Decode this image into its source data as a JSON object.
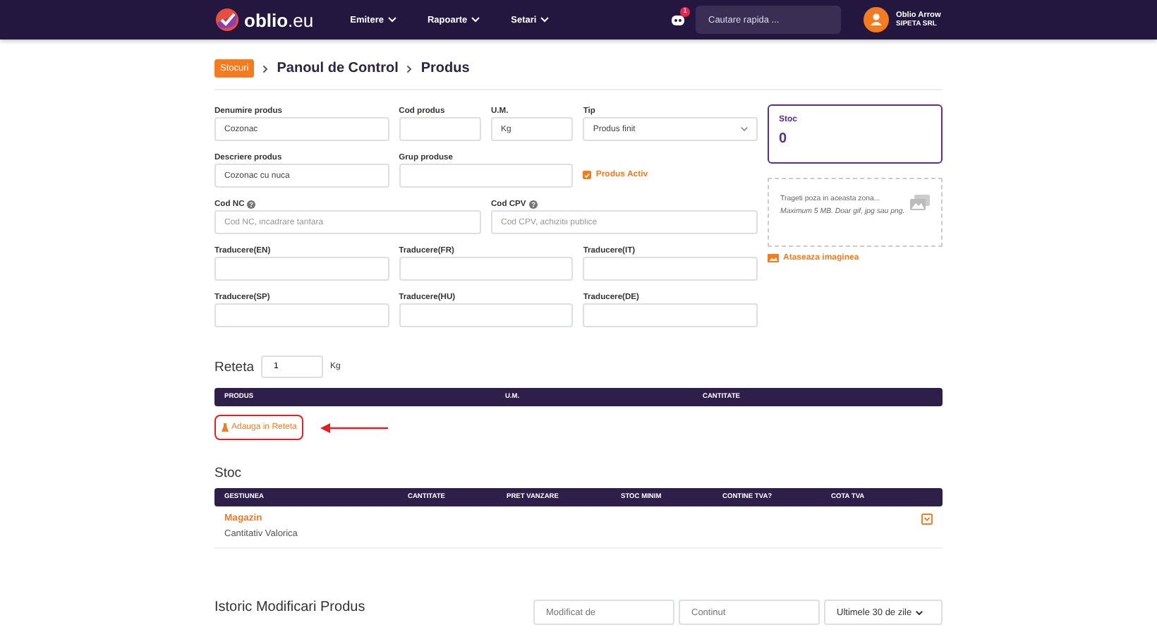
{
  "navbar": {
    "logo": "**oblio**.eu",
    "menu": [
      {
        "label": "Emitere"
      },
      {
        "label": "Rapoarte"
      },
      {
        "label": "Setari"
      }
    ],
    "notifications": "1",
    "search": {
      "placeholder": "Cautare rapida ..."
    },
    "user": {
      "name": "Oblio Arrow",
      "company": "SIPETA SRL"
    }
  },
  "breadcrumb": {
    "tag": "Stocuri",
    "items": [
      "Panoul de Control",
      "Produs"
    ]
  },
  "form_rows": [
    [
      {
        "kind": "text",
        "label": "Denumire produs",
        "value": "Cozonac"
      },
      {
        "kind": "short",
        "label": "Cod produs"
      },
      {
        "kind": "short",
        "label": "U.M.",
        "value": "Kg"
      },
      {
        "kind": "select",
        "label": "Tip",
        "value": "Produs finit"
      }
    ],
    [
      {
        "kind": "text",
        "label": "Descriere produs",
        "value": "Cozonac cu nuca"
      },
      {
        "kind": "text",
        "label": "Grup produse"
      },
      {
        "kind": "checkbox",
        "label": "Produs Activ",
        "checked": true
      }
    ],
    [
      {
        "kind": "text",
        "label": "Cod NC",
        "help_icon": true,
        "placeholder": "Cod NC, incadrare tarifara"
      },
      {
        "kind": "text",
        "label": "Cod CPV",
        "help_icon": true,
        "placeholder": "Cod CPV, achizitii publice"
      }
    ],
    [
      {
        "kind": "text",
        "label": "Traducere(EN)"
      },
      {
        "kind": "text",
        "label": "Traducere(FR)"
      },
      {
        "kind": "text",
        "label": "Traducere(IT)"
      }
    ],
    [
      {
        "kind": "text",
        "label": "Traducere(SP)"
      },
      {
        "kind": "text",
        "label": "Traducere(HU)"
      },
      {
        "kind": "text",
        "label": "Traducere(DE)"
      }
    ]
  ],
  "stock_card": {
    "label": "Stoc",
    "value": "0"
  },
  "upload": {
    "lines": [
      "Trageti poza in aceasta zona...",
      "Maximum 5 MB. Doar gif, jpg sau png."
    ],
    "link": "Ataseaza imaginea"
  },
  "recipe": {
    "title": "Reteta",
    "quantity": "1",
    "unit": "Kg",
    "columns": [
      "PRODUS",
      "U.M.",
      "CANTITATE"
    ],
    "add_button": "Adauga in Reteta",
    "highlighted": true
  },
  "stock": {
    "title": "Stoc",
    "columns": [
      "GESTIUNEA",
      "CANTITATE",
      "PRET VANZARE",
      "STOC MINIM",
      "CONTINE TVA?",
      "COTA TVA"
    ],
    "rows": [
      {
        "name": "Magazin",
        "type": "Cantitativ Valorica"
      }
    ]
  },
  "history": {
    "title": "Istoric Modificari Produs",
    "filters": [
      {
        "kind": "text",
        "placeholder": "Modificat de"
      },
      {
        "kind": "text",
        "placeholder": "Continut"
      },
      {
        "kind": "select",
        "value": "Ultimele 30 de zile"
      }
    ]
  }
}
